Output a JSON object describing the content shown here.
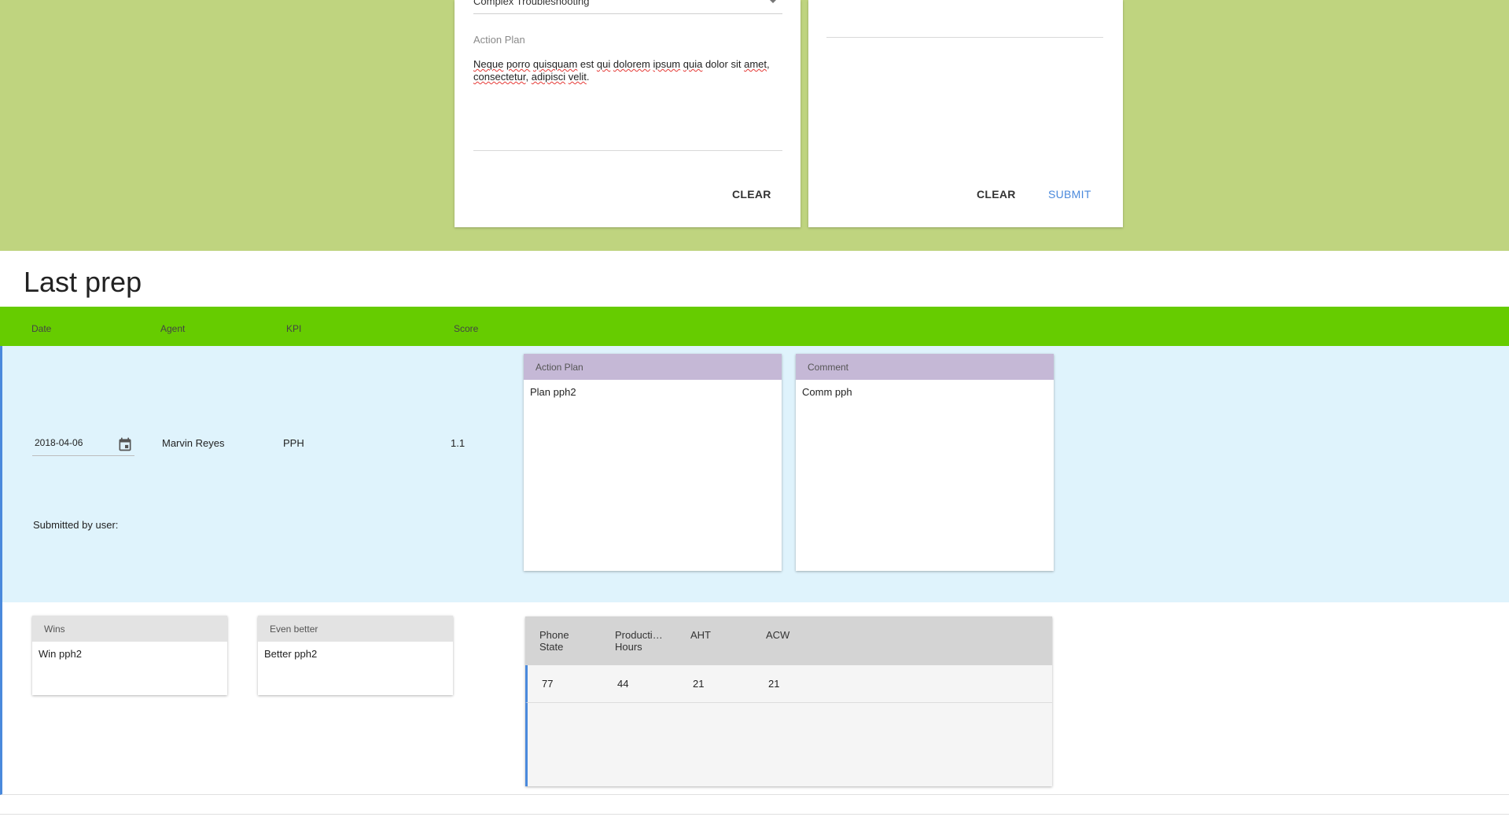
{
  "form": {
    "category_value": "Complex Troubleshooting",
    "action_plan_label": "Action Plan",
    "action_plan_words": [
      {
        "text": "Neque",
        "spell": true
      },
      {
        "text": " "
      },
      {
        "text": "porro",
        "spell": true
      },
      {
        "text": " "
      },
      {
        "text": "quisquam",
        "spell": true
      },
      {
        "text": " est "
      },
      {
        "text": "qui",
        "spell": true
      },
      {
        "text": " "
      },
      {
        "text": "dolorem",
        "spell": true
      },
      {
        "text": " "
      },
      {
        "text": "ipsum",
        "spell": true
      },
      {
        "text": " "
      },
      {
        "text": "quia",
        "spell": true
      },
      {
        "text": " dolor sit "
      },
      {
        "text": "amet",
        "spell": true
      },
      {
        "text": ", "
      },
      {
        "text": "consectetur",
        "spell": true
      },
      {
        "text": ", "
      },
      {
        "text": "adipisci",
        "spell": true
      },
      {
        "text": " "
      },
      {
        "text": "velit",
        "spell": true
      },
      {
        "text": "."
      }
    ],
    "left_clear_label": "CLEAR",
    "right_clear_label": "CLEAR",
    "submit_label": "SUBMIT"
  },
  "section_title": "Last prep",
  "table": {
    "headers": {
      "date": "Date",
      "agent": "Agent",
      "kpi": "KPI",
      "score": "Score"
    },
    "row": {
      "date": "2018-04-06",
      "agent": "Marvin Reyes",
      "kpi": "PPH",
      "score": "1.1",
      "submitted_by_label": "Submitted by user:"
    },
    "action_plan": {
      "title": "Action Plan",
      "text": "Plan pph2"
    },
    "comment": {
      "title": "Comment",
      "text": "Comm pph"
    },
    "wins": {
      "title": "Wins",
      "text": "Win pph2"
    },
    "even_better": {
      "title": "Even better",
      "text": "Better pph2"
    },
    "metrics": {
      "headers": [
        "Phone State",
        "Production Hours",
        "AHT",
        "ACW"
      ],
      "values": [
        "77",
        "44",
        "21",
        "21"
      ]
    }
  },
  "colors": {
    "top_band": "#bfd47f",
    "table_header": "#66cc00",
    "row_bg": "#dff3fc",
    "note_header": "#c5b8d6",
    "accent": "#4a89dc"
  },
  "icons": {
    "date": "calendar-icon",
    "select": "dropdown-arrow-icon"
  }
}
